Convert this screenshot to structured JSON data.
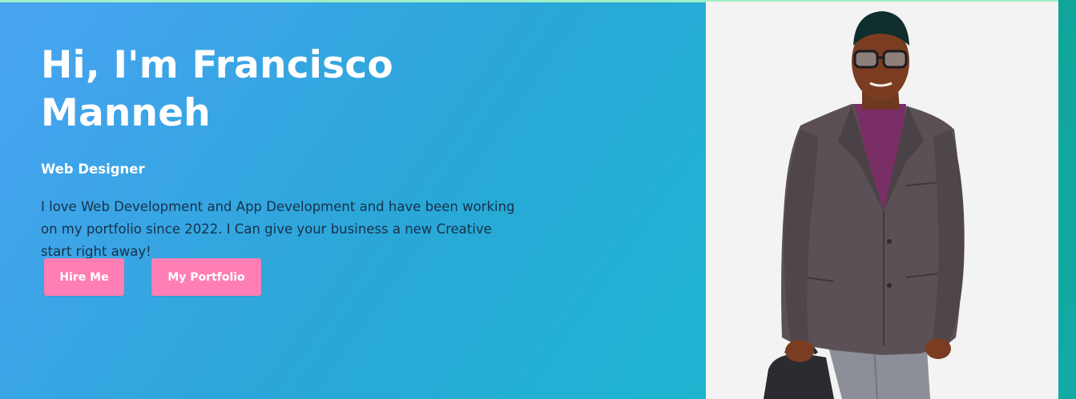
{
  "hero": {
    "headline": "Hi, I'm Francisco Manneh",
    "role": "Web Designer",
    "description": "I love Web Development and App Development and have been working on my portfolio since 2022. I Can give your business a new Creative start right away!",
    "buttons": {
      "hire_label": "Hire Me",
      "portfolio_label": "My Portfolio"
    },
    "colors": {
      "button": "#ff7eb3",
      "gradient_start": "#4aa3f3",
      "gradient_end": "#12a9a6"
    }
  },
  "photo": {
    "icon": "profile-photo"
  }
}
